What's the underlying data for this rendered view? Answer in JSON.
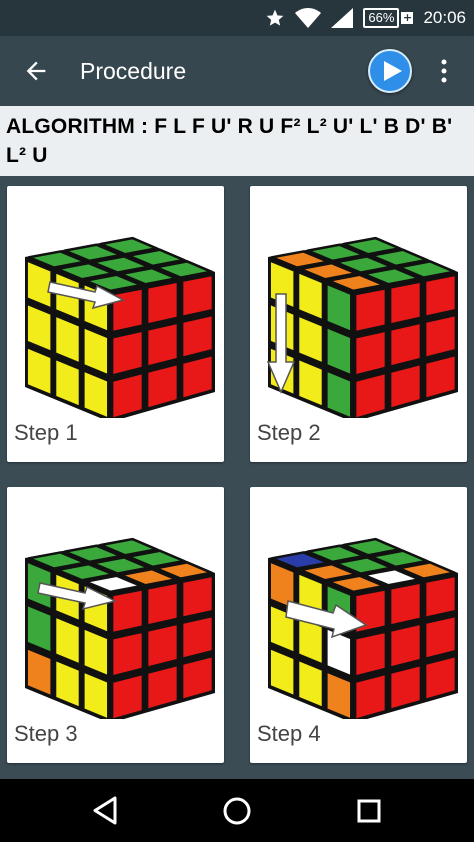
{
  "status_bar": {
    "battery": "66%",
    "time": "20:06",
    "icons": [
      "star-icon",
      "wifi-icon",
      "signal-icon",
      "battery-icon"
    ]
  },
  "toolbar": {
    "title": "Procedure",
    "back_icon": "arrow-back-icon",
    "play_icon": "play-icon",
    "menu_icon": "more-vert-icon"
  },
  "algorithm": {
    "text": "ALGORITHM : F L F U' R U F² L² U' L' B D' B' L² U"
  },
  "steps": [
    {
      "label": "Step 1"
    },
    {
      "label": "Step 2"
    },
    {
      "label": "Step 3"
    },
    {
      "label": "Step 4"
    }
  ],
  "navbar": {
    "icons": [
      "back-triangle-icon",
      "home-icon",
      "recents-icon"
    ]
  },
  "colors": {
    "toolbar": "#37474f",
    "status": "#27363d",
    "background": "#3b4c55",
    "play": "#2f8fe8"
  }
}
